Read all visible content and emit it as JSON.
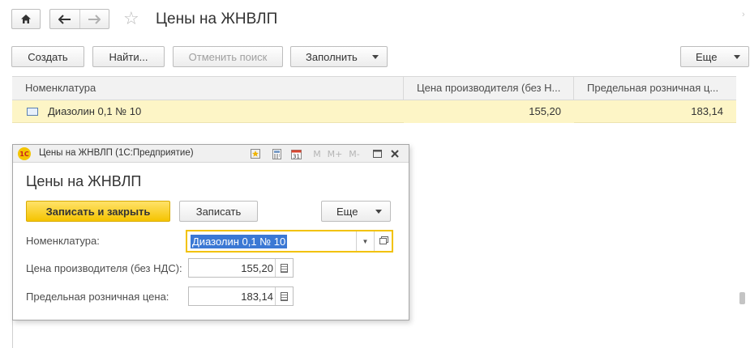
{
  "header": {
    "title": "Цены на ЖНВЛП",
    "home_icon": "home-icon",
    "back_icon": "arrow-left-icon",
    "forward_icon": "arrow-right-icon",
    "favorite_icon": "star-icon"
  },
  "toolbar": {
    "create_label": "Создать",
    "find_label": "Найти...",
    "cancel_search_label": "Отменить поиск",
    "fill_label": "Заполнить",
    "more_label": "Еще"
  },
  "table": {
    "columns": [
      "Номенклатура",
      "Цена производителя (без Н...",
      "Предельная розничная ц..."
    ],
    "rows": [
      {
        "name": "Диазолин 0,1 № 10",
        "manufacturer_price": "155,20",
        "max_retail_price": "183,14"
      }
    ]
  },
  "dialog": {
    "window_title": "Цены на ЖНВЛП  (1С:Предприятие)",
    "logo_text": "1С",
    "heading": "Цены на ЖНВЛП",
    "toolbar_icons": {
      "m_label": "M",
      "m_plus_label": "M+",
      "m_minus_label": "M-"
    },
    "save_close_label": "Записать и закрыть",
    "save_label": "Записать",
    "more_label": "Еще",
    "fields": {
      "nomenclature_label": "Номенклатура:",
      "nomenclature_value": "Диазолин 0,1 № 10",
      "manufacturer_price_label": "Цена производителя (без НДС):",
      "manufacturer_price_value": "155,20",
      "max_retail_price_label": "Предельная розничная цена:",
      "max_retail_price_value": "183,14"
    }
  },
  "colors": {
    "selected_row": "#fdf5c6",
    "primary_button": "#f5c400",
    "focus_border": "#f2c200",
    "selection": "#3b78d4"
  }
}
